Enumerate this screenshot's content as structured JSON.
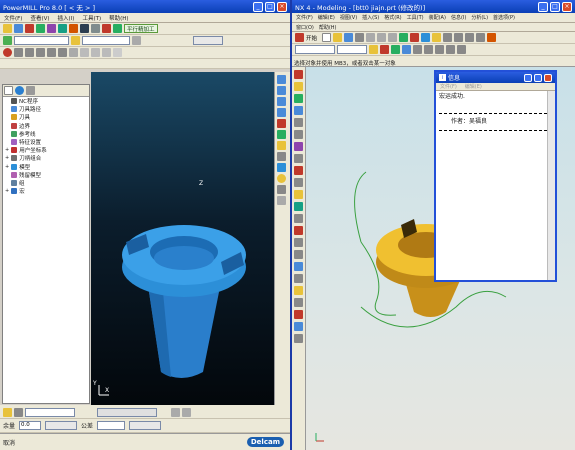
{
  "powermill": {
    "title": "PowerMILL Pro 8.0     [ < 无 > ]",
    "menu": [
      "文件(F)",
      "查看(V)",
      "插入(I)",
      "工具(T)",
      "帮助(H)"
    ],
    "strategy_label": "平行精加工",
    "tree_items": [
      "NC程序",
      "刀具路径",
      "刀具",
      "边界",
      "参考线",
      "特征设置",
      "用户坐标系",
      "刀柄组合",
      "模型",
      "残留模型",
      "组",
      "宏"
    ],
    "status_text": "取消",
    "tolerance_label": "余量",
    "tolerance_value": "0.0",
    "tol_label": "公差",
    "logo": "Delcam",
    "axis_x": "X",
    "axis_y": "Y",
    "axis_z": "Z"
  },
  "nx": {
    "title": "NX 4 - Modeling - [btt0 jiajn.prt  (修改的)]",
    "menu": [
      "文件(F)",
      "编辑(E)",
      "视图(V)",
      "插入(S)",
      "格式(R)",
      "工具(T)",
      "装配(A)",
      "信息(I)",
      "分析(L)",
      "首选项(P)"
    ],
    "menu2": [
      "窗口(O)",
      "帮助(H)"
    ],
    "start_label": "开始",
    "prompt": "选择对象并使用 MB3，或者双击某一对象"
  },
  "info_dialog": {
    "title": "信息",
    "menu": [
      "文件(F)",
      "编辑(E)"
    ],
    "line1": "宏运成功.",
    "line2": "作者：吴福良"
  },
  "colors": {
    "titlebar": "#0a3fb5",
    "part_blue": "#2c8fd8",
    "part_gold": "#e0a81c",
    "toolpath_green": "#3aa040"
  }
}
